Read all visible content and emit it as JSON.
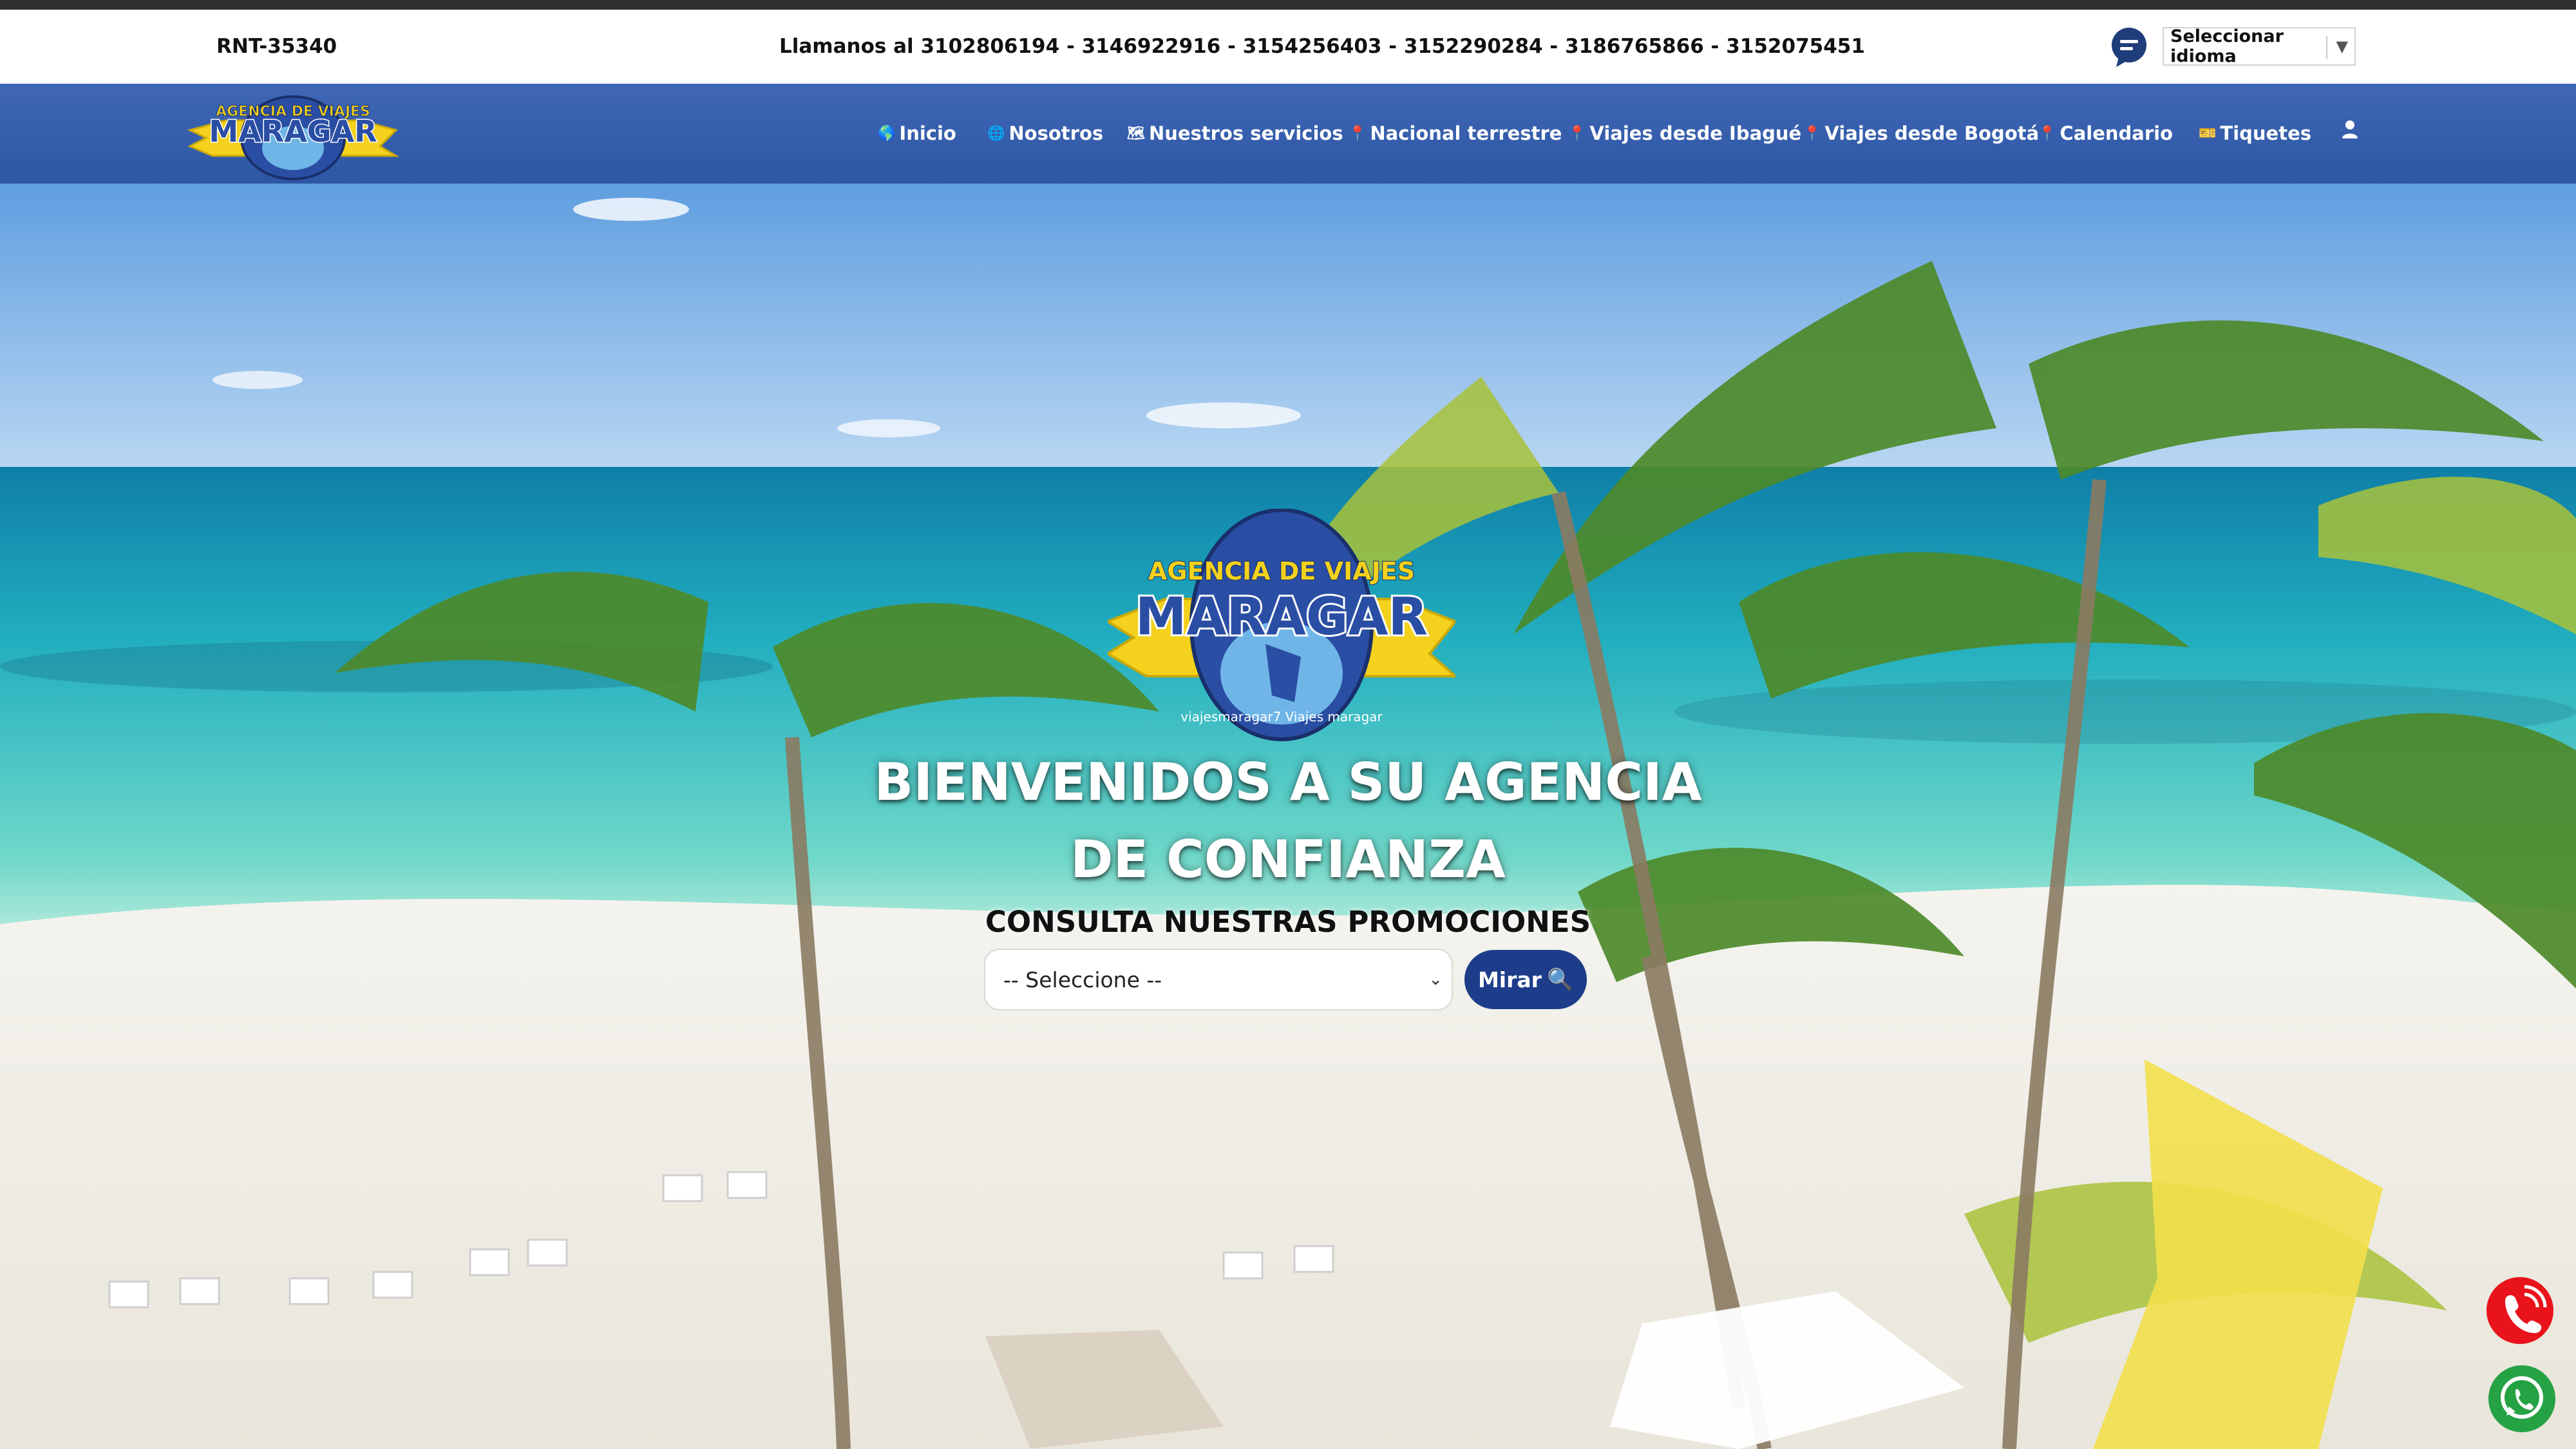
{
  "topbar": {
    "rnt": "RNT-35340",
    "phones": "Llamanos al 3102806194 - 3146922916 - 3154256403 - 3152290284 - 3186765866 - 3152075451",
    "language_select": {
      "selected": "Seleccionar idioma",
      "arrow": "▼"
    }
  },
  "nav": {
    "items": [
      {
        "label": "Inicio",
        "icon": "globe-icon"
      },
      {
        "label": "Nosotros",
        "icon": "globe-icon"
      },
      {
        "label": "Nuestros servicios",
        "icon": "info-icon"
      },
      {
        "label": "Nacional terrestre",
        "icon": "location-icon"
      },
      {
        "label": "Viajes desde Ibagué",
        "icon": "location-icon"
      },
      {
        "label": "Viajes desde Bogotá",
        "icon": "location-icon"
      },
      {
        "label": "Calendario",
        "icon": "location-icon"
      },
      {
        "label": "Tiquetes",
        "icon": "ticket-icon"
      }
    ],
    "user_icon": "user-icon"
  },
  "logo": {
    "line1": "AGENCIA DE VIAJES",
    "line2": "MARAGAR",
    "social": "viajesmaragar7  Viajes maragar"
  },
  "hero": {
    "title": "BIENVENIDOS A SU AGENCIA DE CONFIANZA",
    "subtitle": "CONSULTA NUESTRAS PROMOCIONES",
    "select_value": "-- Seleccione --",
    "button_label": "Mirar"
  },
  "colors": {
    "navbar": "#3a62b0",
    "button": "#1d3d8a",
    "logo_yellow": "#f3d11c",
    "phone_red": "#e8131b",
    "whatsapp_green": "#25a244"
  }
}
